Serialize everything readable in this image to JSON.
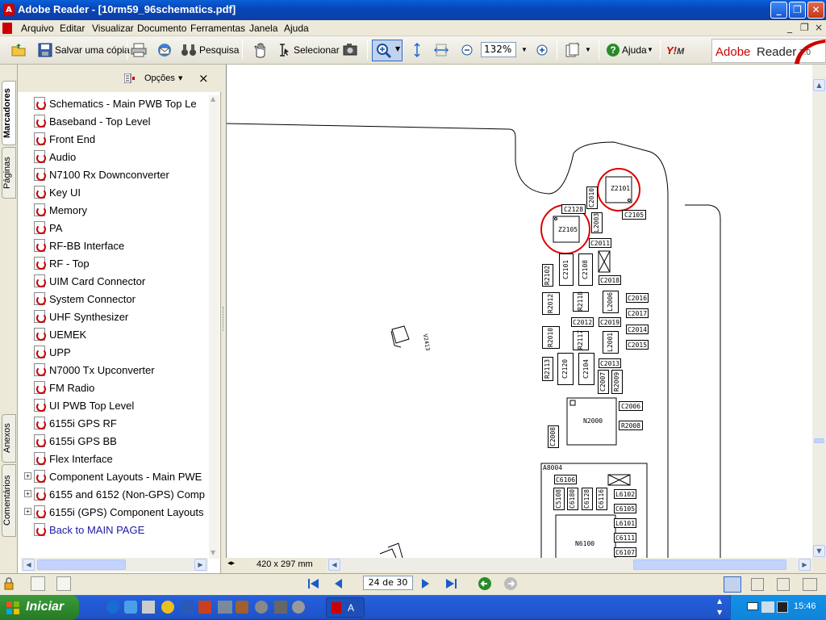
{
  "window": {
    "title": "Adobe Reader - [10rm59_96schematics.pdf]",
    "controls": {
      "minimize": "_",
      "restore": "❐",
      "close": "✕"
    }
  },
  "menubar": {
    "items": [
      "Arquivo",
      "Editar",
      "Visualizar",
      "Documento",
      "Ferramentas",
      "Janela",
      "Ajuda"
    ],
    "mdi_controls": [
      "_",
      "❐",
      "×"
    ]
  },
  "toolbar": {
    "save_copy": "Salvar uma cópia",
    "search": "Pesquisa",
    "select": "Selecionar",
    "zoom": "132%",
    "help": "Ajuda",
    "brand": "Adobe",
    "brand_product": "Reader",
    "brand_version": "7.0"
  },
  "sidetabs": {
    "bookmarks": "Marcadores",
    "pages": "Páginas",
    "attachments": "Anexos",
    "comments": "Comentários"
  },
  "panel": {
    "options": "Opções",
    "close": "×",
    "bookmarks": [
      {
        "label": "Schematics - Main PWB Top Le",
        "expand": false
      },
      {
        "label": "Baseband - Top Level",
        "expand": false
      },
      {
        "label": "Front End",
        "expand": false
      },
      {
        "label": "Audio",
        "expand": false
      },
      {
        "label": "N7100 Rx Downconverter",
        "expand": false
      },
      {
        "label": "Key UI",
        "expand": false
      },
      {
        "label": "Memory",
        "expand": false
      },
      {
        "label": "PA",
        "expand": false
      },
      {
        "label": "RF-BB Interface",
        "expand": false
      },
      {
        "label": "RF - Top",
        "expand": false
      },
      {
        "label": "UIM Card Connector",
        "expand": false
      },
      {
        "label": "System Connector",
        "expand": false
      },
      {
        "label": "UHF Synthesizer",
        "expand": false
      },
      {
        "label": "UEMEK",
        "expand": false
      },
      {
        "label": "UPP",
        "expand": false
      },
      {
        "label": "N7000 Tx Upconverter",
        "expand": false
      },
      {
        "label": "FM Radio",
        "expand": false
      },
      {
        "label": "UI PWB Top Level",
        "expand": false
      },
      {
        "label": "6155i GPS RF",
        "expand": false
      },
      {
        "label": "6155i GPS BB",
        "expand": false
      },
      {
        "label": "Flex Interface",
        "expand": false
      },
      {
        "label": "Component Layouts - Main PWE",
        "expand": true
      },
      {
        "label": "6155 and 6152 (Non-GPS) Comp",
        "expand": true
      },
      {
        "label": "6155i (GPS) Component Layouts",
        "expand": true
      },
      {
        "label": "Back to MAIN PAGE",
        "expand": false,
        "link": true
      }
    ]
  },
  "document": {
    "page_size": "420 x 297 mm",
    "components": {
      "z2101": "Z2101",
      "z2105": "Z2105",
      "c2010": "C2010",
      "c2128": "C2128",
      "l2003": "L2003",
      "c2105": "C2105",
      "c2011": "C2011",
      "r2102": "R2102",
      "c2101": "C2101",
      "c2108": "C2108",
      "c2018": "C2018",
      "r2012": "R2012",
      "r2118": "R2118",
      "l2006": "L2006",
      "c2016": "C2016",
      "c2017": "C2017",
      "c2012": "C2012",
      "c2019": "C2019",
      "c2014": "C2014",
      "r2010": "R2010",
      "r2117": "R2117",
      "l2001": "L2001",
      "c2015": "C2015",
      "c2013": "C2013",
      "r2113": "R2113",
      "c2120": "C2120",
      "c2104": "C2104",
      "c2007": "C2007",
      "r2009": "R2009",
      "c2006": "C2006",
      "n2000": "N2000",
      "r2008": "R2008",
      "c2008": "C2008",
      "a8004": "A8004",
      "c6106": "C6106",
      "c5108": "C5108",
      "c6180": "C6180",
      "c6128": "C6128",
      "c6116": "C6116",
      "l6102": "L6102",
      "c6105": "C6105",
      "l6101": "L6101",
      "c6111": "C6111",
      "n6100": "N6100",
      "c6107": "C6107",
      "v2413": "V2413"
    }
  },
  "statusbar": {
    "page_indicator": "24 de 30"
  },
  "taskbar": {
    "start": "Iniciar",
    "task": "A",
    "clock": "15:46"
  }
}
